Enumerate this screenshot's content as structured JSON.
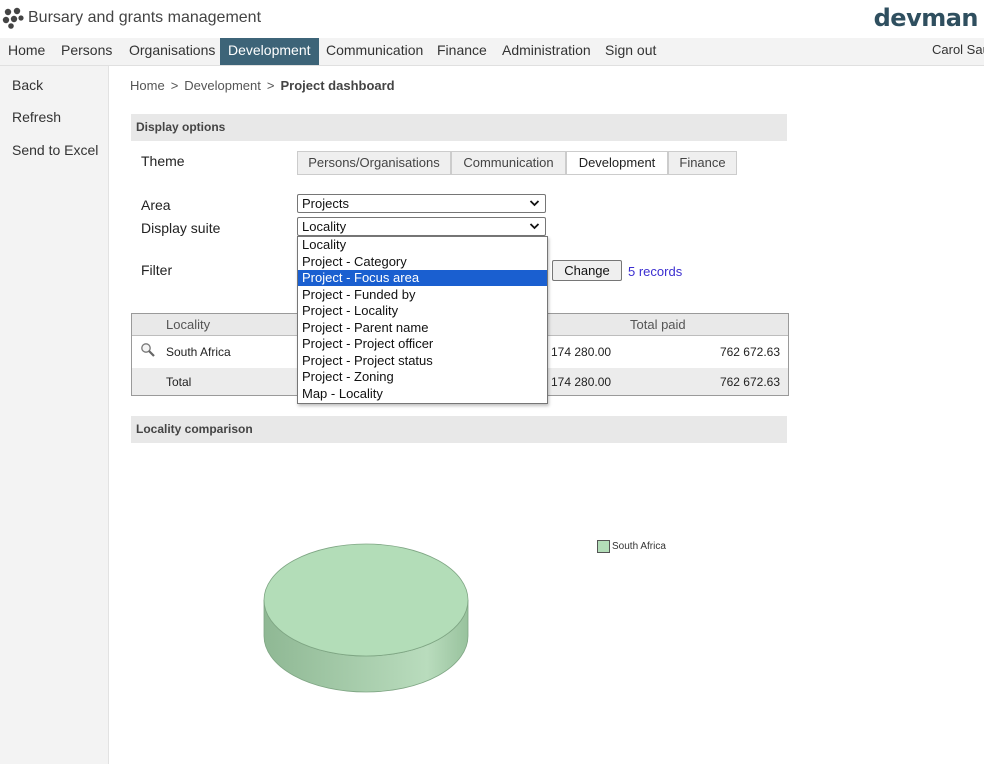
{
  "app": {
    "title": "Bursary and grants management",
    "brand": "devman",
    "logo_icon": "app-logo-icon"
  },
  "nav": {
    "items": [
      "Home",
      "Persons",
      "Organisations",
      "Development",
      "Communication",
      "Finance",
      "Administration",
      "Sign out"
    ],
    "active": "Development",
    "user": "Carol Sau"
  },
  "sidebar": {
    "items": [
      "Back",
      "Refresh",
      "Send to Excel"
    ]
  },
  "breadcrumb": {
    "items": [
      "Home",
      "Development"
    ],
    "separator": ">",
    "current": "Project dashboard"
  },
  "display_options": {
    "heading": "Display options",
    "theme_label": "Theme",
    "theme_tabs": [
      "Persons/Organisations",
      "Communication",
      "Development",
      "Finance"
    ],
    "theme_selected": "Development",
    "area_label": "Area",
    "area_value": "Projects",
    "suite_label": "Display suite",
    "suite_value": "Locality",
    "filter_label": "Filter",
    "change_button": "Change",
    "records": "5 records"
  },
  "suite_dropdown": {
    "options": [
      "Locality",
      "Project - Category",
      "Project - Focus area",
      "Project - Funded by",
      "Project - Locality",
      "Project - Parent name",
      "Project - Project officer",
      "Project - Project status",
      "Project - Zoning",
      "Map - Locality"
    ],
    "highlighted": "Project - Focus area"
  },
  "table": {
    "headers": {
      "locality": "Locality",
      "total_paid": "Total paid"
    },
    "rows": [
      {
        "locality": "South Africa",
        "partial_amount": "174 280.00",
        "total_paid": "762 672.63",
        "icon": "zoom-icon"
      }
    ],
    "total": {
      "label": "Total",
      "partial_amount": "174 280.00",
      "total_paid": "762 672.63"
    }
  },
  "comparison": {
    "heading": "Locality comparison"
  },
  "chart_data": {
    "type": "pie",
    "categories": [
      "South Africa"
    ],
    "values": [
      762672.63
    ],
    "title": "",
    "legend": [
      "South Africa"
    ],
    "legend_position": "right",
    "colors": [
      "#b3ddb8"
    ]
  },
  "colors": {
    "nav_active": "#3d6478",
    "highlight": "#1a5fd0",
    "link": "#3b2ed0",
    "brand": "#2f4f5f"
  }
}
